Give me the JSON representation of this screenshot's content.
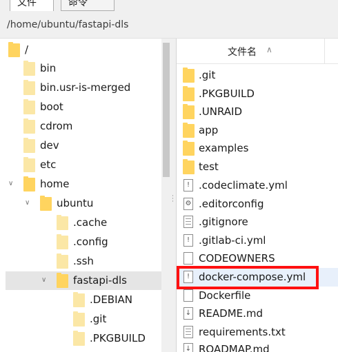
{
  "tabs": [
    {
      "label": "文件"
    },
    {
      "label": "命令"
    }
  ],
  "path": "/home/ubuntu/fastapi-dls",
  "tree": [
    {
      "label": "/"
    },
    {
      "label": "bin"
    },
    {
      "label": "bin.usr-is-merged"
    },
    {
      "label": "boot"
    },
    {
      "label": "cdrom"
    },
    {
      "label": "dev"
    },
    {
      "label": "etc"
    },
    {
      "label": "home"
    },
    {
      "label": "ubuntu"
    },
    {
      "label": ".cache"
    },
    {
      "label": ".config"
    },
    {
      "label": ".ssh"
    },
    {
      "label": "fastapi-dls"
    },
    {
      "label": ".DEBIAN"
    },
    {
      "label": ".git"
    },
    {
      "label": ".PKGBUILD"
    }
  ],
  "file_list": {
    "column_header": "文件名",
    "items": [
      {
        "name": ".git"
      },
      {
        "name": ".PKGBUILD"
      },
      {
        "name": ".UNRAID"
      },
      {
        "name": "app"
      },
      {
        "name": "examples"
      },
      {
        "name": "test"
      },
      {
        "name": ".codeclimate.yml"
      },
      {
        "name": ".editorconfig"
      },
      {
        "name": ".gitignore"
      },
      {
        "name": ".gitlab-ci.yml"
      },
      {
        "name": "CODEOWNERS"
      },
      {
        "name": "docker-compose.yml"
      },
      {
        "name": "Dockerfile"
      },
      {
        "name": "README.md"
      },
      {
        "name": "requirements.txt"
      },
      {
        "name": "ROADMAP.md"
      }
    ]
  },
  "icons": {
    "folder_color": "#ffd45f",
    "highlight_color": "#ff1010"
  }
}
